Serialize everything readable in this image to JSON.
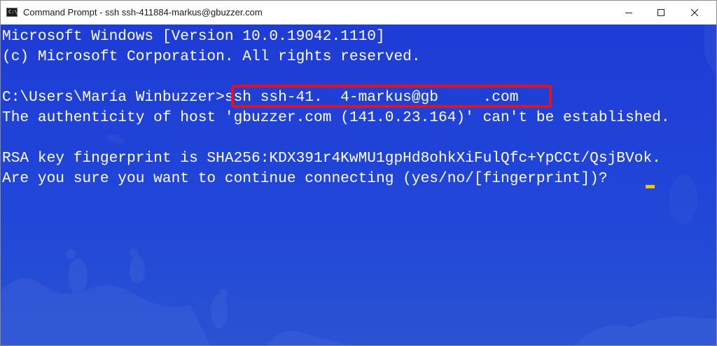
{
  "window": {
    "title": "Command Prompt - ssh  ssh-411884-markus@gbuzzer.com",
    "icon_glyph": "C:\\_",
    "controls": {
      "minimize": "minimize-icon",
      "maximize": "maximize-icon",
      "close": "close-icon"
    }
  },
  "console": {
    "background_color": "#1f3fd4",
    "text_color": "#ffffff",
    "highlight_color": "#e0141e",
    "cursor_color": "#f5c400",
    "lines": [
      "Microsoft Windows [Version 10.0.19042.1110]",
      "(c) Microsoft Corporation. All rights reserved.",
      "C:\\Users\\María Winbuzzer>ssh ssh-41.  4-markus@gb     .com",
      "The authenticity of host 'gbuzzer.com (141.0.23.164)' can't be established.",
      "RSA key fingerprint is SHA256:KDX391r4KwMU1gpHd8ohkXiFulQfc+YpCCt/QsjBVok.",
      "Are you sure you want to continue connecting (yes/no/[fingerprint])? "
    ]
  }
}
